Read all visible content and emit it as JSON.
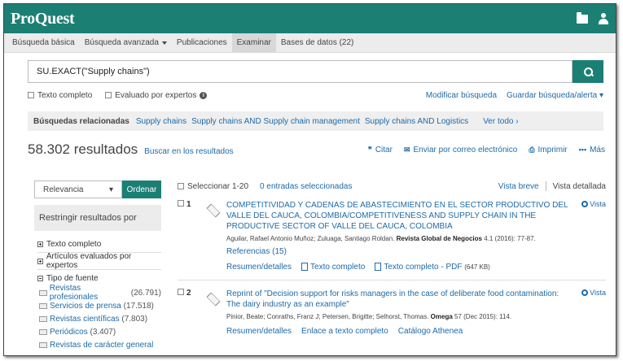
{
  "brand": "ProQuest",
  "nav": {
    "items": [
      "Búsqueda básica",
      "Búsqueda avanzada",
      "Publicaciones",
      "Examinar",
      "Bases de datos (22)"
    ]
  },
  "search": {
    "query": "SU.EXACT(\"Supply chains\")"
  },
  "options": {
    "full_text": "Texto completo",
    "peer_reviewed": "Evaluado por expertos",
    "modify": "Modificar búsqueda",
    "save": "Guardar búsqueda/alerta ▾"
  },
  "related": {
    "label": "Búsquedas relacionadas",
    "items": [
      "Supply chains",
      "Supply chains AND Supply chain management",
      "Supply chains AND Logistics"
    ],
    "see_all": "Ver todo ›"
  },
  "results": {
    "count": "58.302 resultados",
    "search_within": "Buscar en los resultados",
    "actions": {
      "cite": "Citar",
      "email": "Enviar por correo electrónico",
      "print": "Imprimir",
      "more": "Más"
    }
  },
  "sidebar": {
    "sort_value": "Relevancia",
    "sort_button": "Ordenar",
    "restrict_label": "Restringir resultados por",
    "facets": [
      "Texto completo",
      "Artículos evaluados por expertos"
    ],
    "source_type_label": "Tipo de fuente",
    "sources": [
      {
        "label": "Revistas profesionales",
        "count": "(26.791)"
      },
      {
        "label": "Servicios de prensa",
        "count": "(17.518)"
      },
      {
        "label": "Revistas científicas",
        "count": "(7.803)"
      },
      {
        "label": "Periódicos",
        "count": "(3.407)"
      },
      {
        "label": "Revistas de carácter general",
        "count": ""
      }
    ]
  },
  "list": {
    "select_label": "Seleccionar 1-20",
    "selected_label": "0 entradas seleccionadas",
    "brief_view": "Vista breve",
    "detailed_view": "Vista detallada",
    "items": [
      {
        "num": "1",
        "title": "COMPETITIVIDAD Y CADENAS DE ABASTECIMIENTO EN EL SECTOR PRODUCTIVO DEL VALLE DEL CAUCA, COLOMBIA/COMPETITIVENESS AND SUPPLY CHAIN IN THE PRODUCTIVE SECTOR OF VALLE DEL CAUCA, COLOMBIA",
        "authors": "Aguilar, Rafael Antonio Muñoz; Zuluaga, Santiago Roldan.",
        "journal": "Revista Global de Negocios",
        "details": "4.1  (2016): 77-87.",
        "refs": "Referencias (15)",
        "links": [
          "Resumen/detalles",
          "Texto completo",
          "Texto completo - PDF"
        ],
        "pdf_size": "(647 KB)",
        "vista": "Vista"
      },
      {
        "num": "2",
        "title": "Reprint of \"Decision support for risks managers in the case of deliberate food contamination: The dairy industry as an example\"",
        "authors": "Pinior, Beate; Conraths, Franz J; Petersen, Brigitte; Selhorst, Thomas.",
        "journal": "Omega",
        "details": "57  (Dec 2015): 114.",
        "links": [
          "Resumen/detalles",
          "Enlace a texto completo",
          "Catálogo Athenea"
        ],
        "vista": "Vista"
      }
    ]
  },
  "colors": {
    "brand": "#1c7f74",
    "link": "#1e6aa8"
  }
}
